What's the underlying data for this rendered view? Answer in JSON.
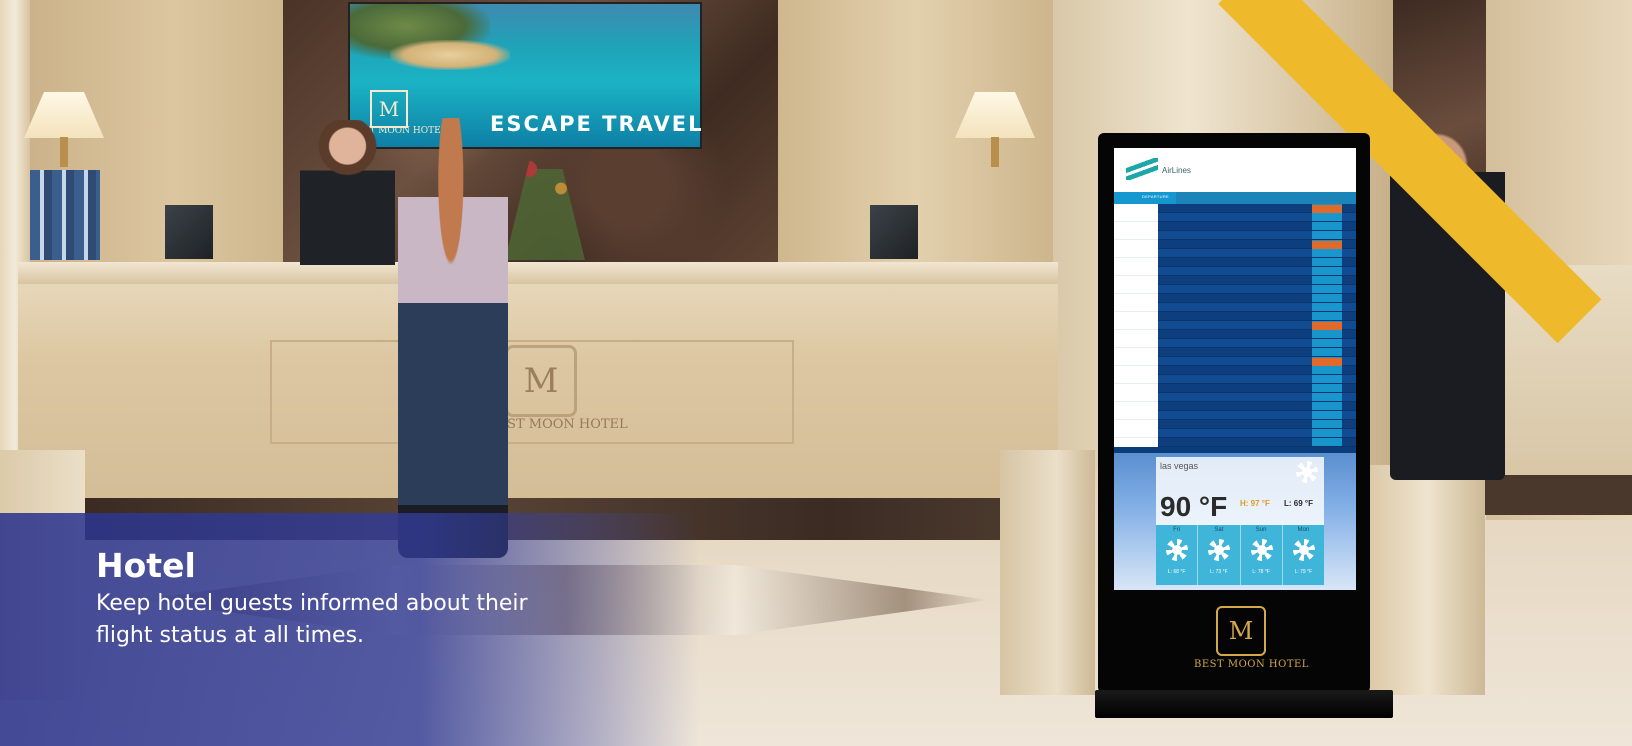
{
  "caption": {
    "title": "Hotel",
    "body": "Keep hotel guests informed about their flight status at all times."
  },
  "wall_art": {
    "title": "ESCAPE TRAVEL",
    "emblem": "M",
    "brand": "BEST MOON HOTEL"
  },
  "desk": {
    "emblem": "M",
    "brand": "BEST MOON HOTEL"
  },
  "kiosk": {
    "brand": "BEST MOON HOTEL",
    "emblem": "M",
    "screen": {
      "airline_label": "AirLines",
      "tab_label": "DEPARTURE",
      "weather": {
        "city": "las vegas",
        "temperature": "90 °F",
        "high": "H: 97 °F",
        "low": "L: 69 °F",
        "forecast": [
          {
            "day": "Fri",
            "low": "L: 68 °F"
          },
          {
            "day": "Sat",
            "low": "L: 73 °F"
          },
          {
            "day": "Sun",
            "low": "L: 78 °F"
          },
          {
            "day": "Mon",
            "low": "L: 79 °F"
          }
        ]
      }
    }
  },
  "colors": {
    "overlay": "#2c348c",
    "ribbon": "#eeba2b",
    "kiosk_gold": "#d4a84b"
  }
}
